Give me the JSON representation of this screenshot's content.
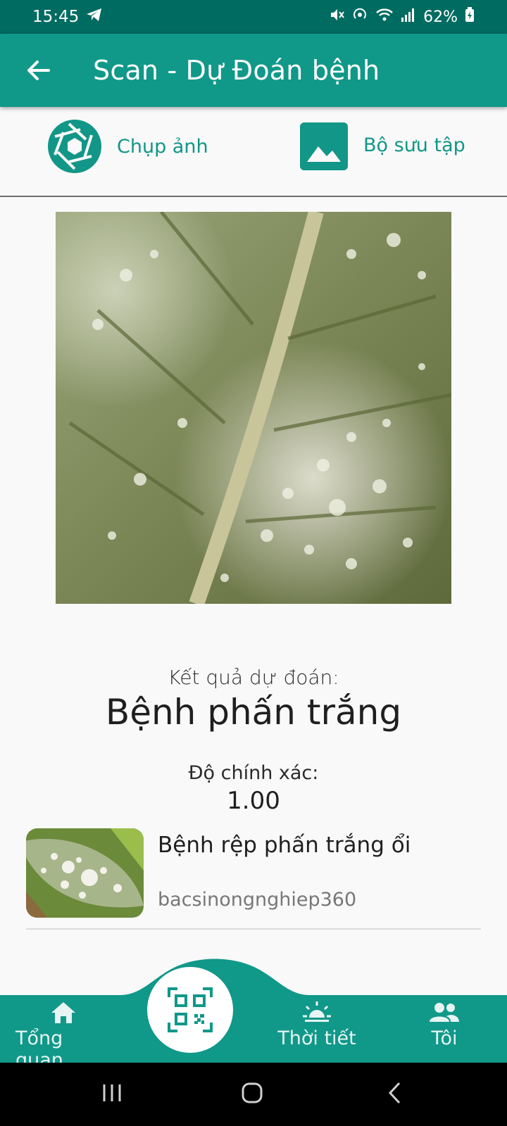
{
  "status_bar": {
    "time": "15:45",
    "battery": "62%"
  },
  "header": {
    "title": "Scan - Dự Đoán bệnh"
  },
  "picker": {
    "camera_label": "Chụp ảnh",
    "gallery_label": "Bộ sưu tập"
  },
  "result": {
    "label": "Kết quả dự đoán:",
    "value": "Bệnh phấn trắng",
    "accuracy_label": "Độ chính xác:",
    "accuracy_value": "1.00"
  },
  "article": {
    "title": "Bệnh rệp phấn trắng ổi",
    "source": "bacsinongnghiep360"
  },
  "bottom_nav": {
    "items": [
      {
        "label": "Tổng quan",
        "icon": "home-icon"
      },
      {
        "label": "",
        "icon": "qr-scan-icon"
      },
      {
        "label": "Thời tiết",
        "icon": "weather-icon"
      },
      {
        "label": "Tôi",
        "icon": "people-icon"
      }
    ]
  },
  "colors": {
    "primary": "#109889",
    "primary_dark": "#006b61",
    "accent_text": "#129687"
  }
}
